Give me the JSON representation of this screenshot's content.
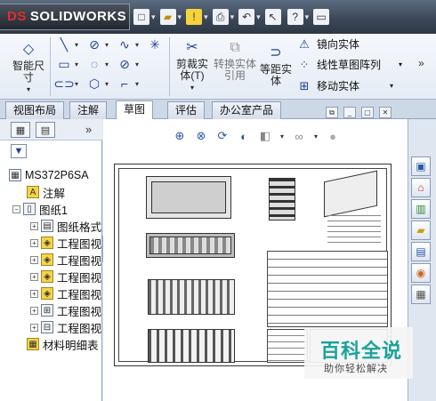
{
  "app": {
    "brand": "SOLIDWORKS",
    "brand_mark": "DS"
  },
  "colors": {
    "titlebar": "#3a4656",
    "ribbon": "#eef2f8",
    "watermark_text": "#1aa39a",
    "accent_blue": "#1f3e9a"
  },
  "quick_access": [
    {
      "icon": "new-document-icon"
    },
    {
      "icon": "open-folder-icon"
    },
    {
      "icon": "warning-icon"
    },
    {
      "icon": "print-icon"
    },
    {
      "icon": "undo-icon"
    },
    {
      "icon": "pointer-icon"
    },
    {
      "icon": "help-icon"
    },
    {
      "icon": "options-icon"
    }
  ],
  "ribbon": {
    "smart_dimension": "智能尺寸",
    "cut_entity": "剪裁实体(T)",
    "convert_entity": "转换实体引用",
    "offset_entity": "等距实体",
    "mirror_entity": "镜向实体",
    "linear_pattern": "线性草图阵列",
    "move_entity": "移动实体"
  },
  "tabs": [
    "视图布局",
    "注解",
    "草图",
    "评估",
    "办公室产品"
  ],
  "active_tab": "草图",
  "feature_tree": {
    "root": "MS372P6SA",
    "items": [
      {
        "label": "注解",
        "level": 1
      },
      {
        "label": "图纸1",
        "level": 1
      },
      {
        "label": "图纸格式",
        "level": 2
      },
      {
        "label": "工程图视",
        "level": 2
      },
      {
        "label": "工程图视",
        "level": 2
      },
      {
        "label": "工程图视",
        "level": 2
      },
      {
        "label": "工程图视",
        "level": 2
      },
      {
        "label": "工程图视",
        "level": 2
      },
      {
        "label": "工程图视",
        "level": 2
      },
      {
        "label": "材料明细表",
        "level": 1
      }
    ]
  },
  "watermark": {
    "title": "百科全说",
    "subtitle": "助你轻松解决"
  }
}
